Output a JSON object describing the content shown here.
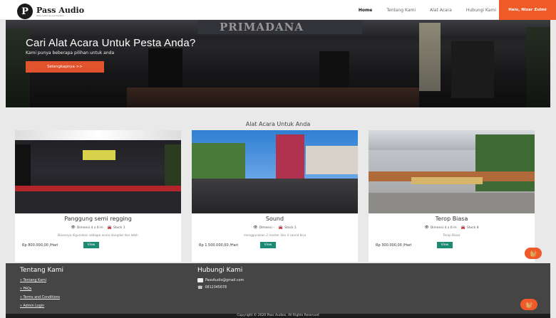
{
  "brand": {
    "name": "Pass Audio",
    "tagline": "Pass Audio Sound System"
  },
  "nav": {
    "links": [
      "Home",
      "Tentang Kami",
      "Alat Acara",
      "Hubungi Kami"
    ],
    "user": "Halo, Nizar Zulmi"
  },
  "hero": {
    "title": "Cari Alat Acara Untuk Pesta Anda?",
    "subtitle": "Kami punya beberapa pilihan untuk anda",
    "button": "Selengkapnya >>",
    "banner_text": "PRIMADANA"
  },
  "section": {
    "title": "Alat Acara Untuk Anda"
  },
  "products": [
    {
      "name": "Panggung semi regging",
      "dimension": "Dimensi 4 x 6 m",
      "stock": "Stock 1",
      "description": "Biasanya digunakan sebagai acara dangdut dan lebih",
      "price": "Rp 800.000,00 /Hari",
      "view_label": "View"
    },
    {
      "name": "Sound",
      "dimension": "Dimensi -",
      "stock": "Stock 1",
      "description": "menggunakan 2 master dan 4 sound bisa",
      "price": "Rp 1.500.000,00 /Hari",
      "view_label": "View"
    },
    {
      "name": "Terop Biasa",
      "dimension": "Dimensi 4 x 6 m",
      "stock": "Stock 8",
      "description": "Terop Biasa",
      "price": "Rp 300.000,00 /Hari",
      "view_label": "View"
    }
  ],
  "footer": {
    "about_title": "Tentang Kami",
    "links": [
      "Tentang Kami",
      "FAQs",
      "Terms and Conditions",
      "Admin Login"
    ],
    "contact_title": "Hubungi Kami",
    "email": "PassAudio@gmail.com",
    "phone": "0812345678",
    "copyright": "Copyright © 2020 Pass Audios. All Rights Reserved"
  },
  "icons": {
    "view": "eye-icon",
    "stock": "car-icon",
    "cart": "cart-icon",
    "email": "envelope-icon",
    "phone": "phone-icon"
  },
  "colors": {
    "accent": "#f05a28",
    "view_button": "#1c8a74",
    "footer": "#454545"
  }
}
